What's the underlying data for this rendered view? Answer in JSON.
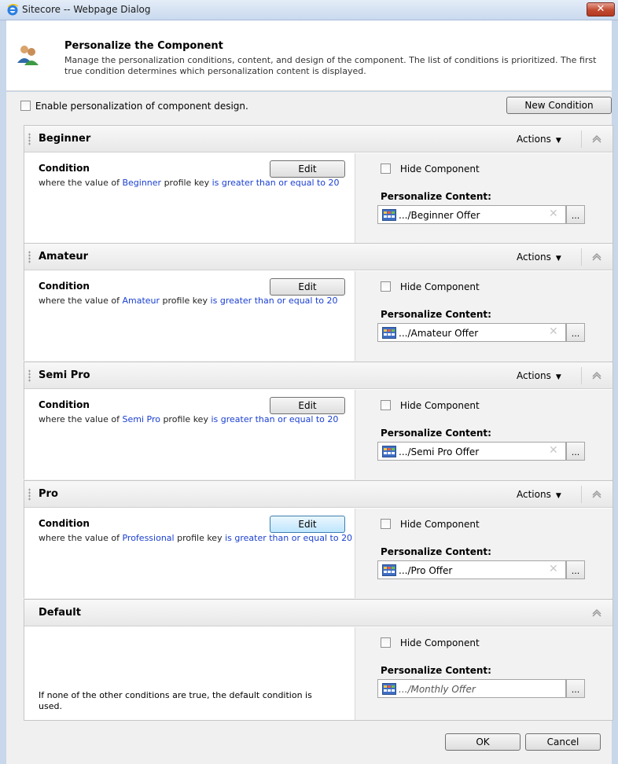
{
  "window": {
    "title": "Sitecore -- Webpage Dialog",
    "close_label": "✕"
  },
  "header": {
    "title": "Personalize the Component",
    "description": "Manage the personalization conditions, content, and design of the component. The list of conditions is prioritized. The first true condition determines which personalization content is displayed."
  },
  "toolbar": {
    "enable_label": "Enable personalization of component design.",
    "new_condition_label": "New Condition"
  },
  "rule_labels": {
    "actions": "Actions",
    "condition": "Condition",
    "edit": "Edit",
    "hide_component": "Hide Component",
    "personalize_content": "Personalize Content:",
    "where_prefix": "where the value of ",
    "profile_key": " profile key ",
    "operator": "is greater than or equal to",
    "value": "20"
  },
  "rules": [
    {
      "name": "Beginner",
      "profile": "Beginner",
      "content": ".../Beginner Offer"
    },
    {
      "name": "Amateur",
      "profile": "Amateur",
      "content": ".../Amateur Offer"
    },
    {
      "name": "Semi Pro",
      "profile": "Semi Pro",
      "content": ".../Semi Pro Offer"
    },
    {
      "name": "Pro",
      "profile": "Professional",
      "content": ".../Pro Offer"
    }
  ],
  "default_rule": {
    "name": "Default",
    "text": "If none of the other conditions are true, the default condition is used.",
    "content": ".../Monthly Offer"
  },
  "footer": {
    "ok_label": "OK",
    "cancel_label": "Cancel"
  },
  "colors": {
    "link": "#1a3fd1",
    "close_button": "#c24a2f",
    "titlebar": "#c9d9ee"
  },
  "icons": [
    "ie-icon",
    "people-icon",
    "grip-icon",
    "collapse-icon",
    "item-icon",
    "clear-icon",
    "browse-icon"
  ]
}
